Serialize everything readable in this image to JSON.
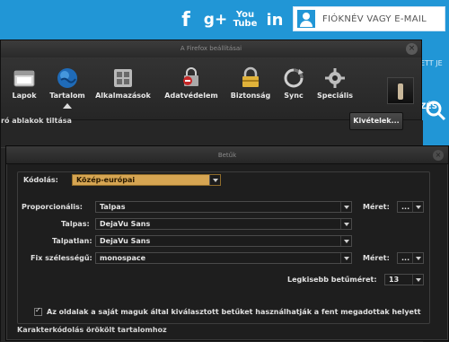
{
  "website": {
    "social_icons": [
      "facebook-icon",
      "google-plus-icon",
      "youtube-icon",
      "linkedin-icon"
    ],
    "social_labels": {
      "facebook": "f",
      "google_plus": "g+",
      "youtube_top": "You",
      "youtube_bottom": "Tube",
      "linkedin": "in"
    },
    "login_placeholder": "FIÓKNÉV VAGY E-MAIL",
    "fragment_1": "ETT JE",
    "fragment_2": "ZÉS",
    "colors": {
      "brand": "#2196d6"
    }
  },
  "prefs_window": {
    "title": "A Firefox beállításai",
    "toolbar": [
      {
        "label": "Lapok",
        "icon": "tabs-icon"
      },
      {
        "label": "Tartalom",
        "icon": "content-globe-icon"
      },
      {
        "label": "Alkalmazások",
        "icon": "applications-icon"
      },
      {
        "label": "Adatvédelem",
        "icon": "privacy-mask-icon"
      },
      {
        "label": "Biztonság",
        "icon": "security-lock-icon"
      },
      {
        "label": "Sync",
        "icon": "sync-icon"
      },
      {
        "label": "Speciális",
        "icon": "advanced-gear-icon"
      }
    ],
    "selected_tab": "Tartalom",
    "popup_label": "ró ablakok tiltása",
    "exceptions_button": "Kivételek..."
  },
  "fonts_dialog": {
    "title": "Betűk",
    "encoding_label": "Kódolás:",
    "encoding_value": "Közép-európai",
    "proportional_label": "Proporcionális:",
    "proportional_value": "Talpas",
    "size_label": "Méret:",
    "size_value": "...",
    "serif_label": "Talpas:",
    "serif_value": "DejaVu Sans",
    "sans_label": "Talpatlan:",
    "sans_value": "DejaVu Sans",
    "mono_label": "Fix szélességű:",
    "mono_value": "monospace",
    "mono_size_label": "Méret:",
    "mono_size_value": "...",
    "min_size_label": "Legkisebb betűméret:",
    "min_size_value": "13",
    "allow_pages_label": "Az oldalak a saját maguk által kiválasztott betűket használhatják a fent megadottak helyett",
    "allow_pages_checked": true,
    "fallback_label": "Karakterkódolás örökölt tartalomhoz"
  }
}
